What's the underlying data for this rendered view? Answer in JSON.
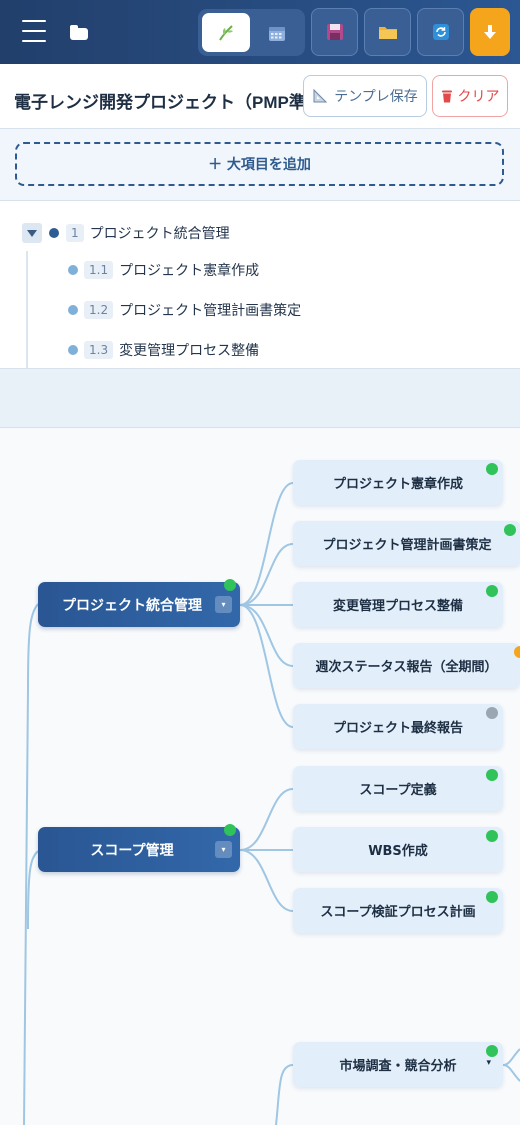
{
  "header": {
    "menu_icon": "hamburger-icon",
    "folder_icon": "folder-icon",
    "view_toggle": {
      "active": "mindmap",
      "items": [
        "mindmap-icon",
        "calendar-icon"
      ]
    },
    "toolbar": [
      "save-icon",
      "open-folder-icon",
      "refresh-icon",
      "download-icon"
    ]
  },
  "project": {
    "title": "電子レンジ開発プロジェクト（PMP準拠）",
    "template_save_label": "テンプレ保存",
    "clear_label": "クリア"
  },
  "add_section": {
    "add_label": "＋ 大項目を追加"
  },
  "outline": {
    "items": [
      {
        "num": "1",
        "label": "プロジェクト統合管理"
      },
      {
        "num": "1.1",
        "label": "プロジェクト憲章作成"
      },
      {
        "num": "1.2",
        "label": "プロジェクト管理計画書策定"
      },
      {
        "num": "1.3",
        "label": "変更管理プロセス整備"
      }
    ]
  },
  "mindmap": {
    "groups": [
      {
        "label": "プロジェクト統合管理",
        "status": "done",
        "children": [
          {
            "label": "プロジェクト憲章作成",
            "status": "done"
          },
          {
            "label": "プロジェクト管理計画書策定",
            "status": "done"
          },
          {
            "label": "変更管理プロセス整備",
            "status": "done"
          },
          {
            "label": "週次ステータス報告（全期間）",
            "status": "in-progress"
          },
          {
            "label": "プロジェクト最終報告",
            "status": "not-started"
          }
        ]
      },
      {
        "label": "スコープ管理",
        "status": "done",
        "children": [
          {
            "label": "スコープ定義",
            "status": "done"
          },
          {
            "label": "WBS作成",
            "status": "done"
          },
          {
            "label": "スコープ検証プロセス計画",
            "status": "done"
          }
        ]
      },
      {
        "label": "",
        "children": [
          {
            "label": "市場調査・競合分析",
            "status": "done"
          }
        ]
      }
    ],
    "status_colors": {
      "done": "#2fc35a",
      "in-progress": "#f5a51c",
      "not-started": "#9aa6b2"
    },
    "connector_color": "#9fc6e3"
  }
}
